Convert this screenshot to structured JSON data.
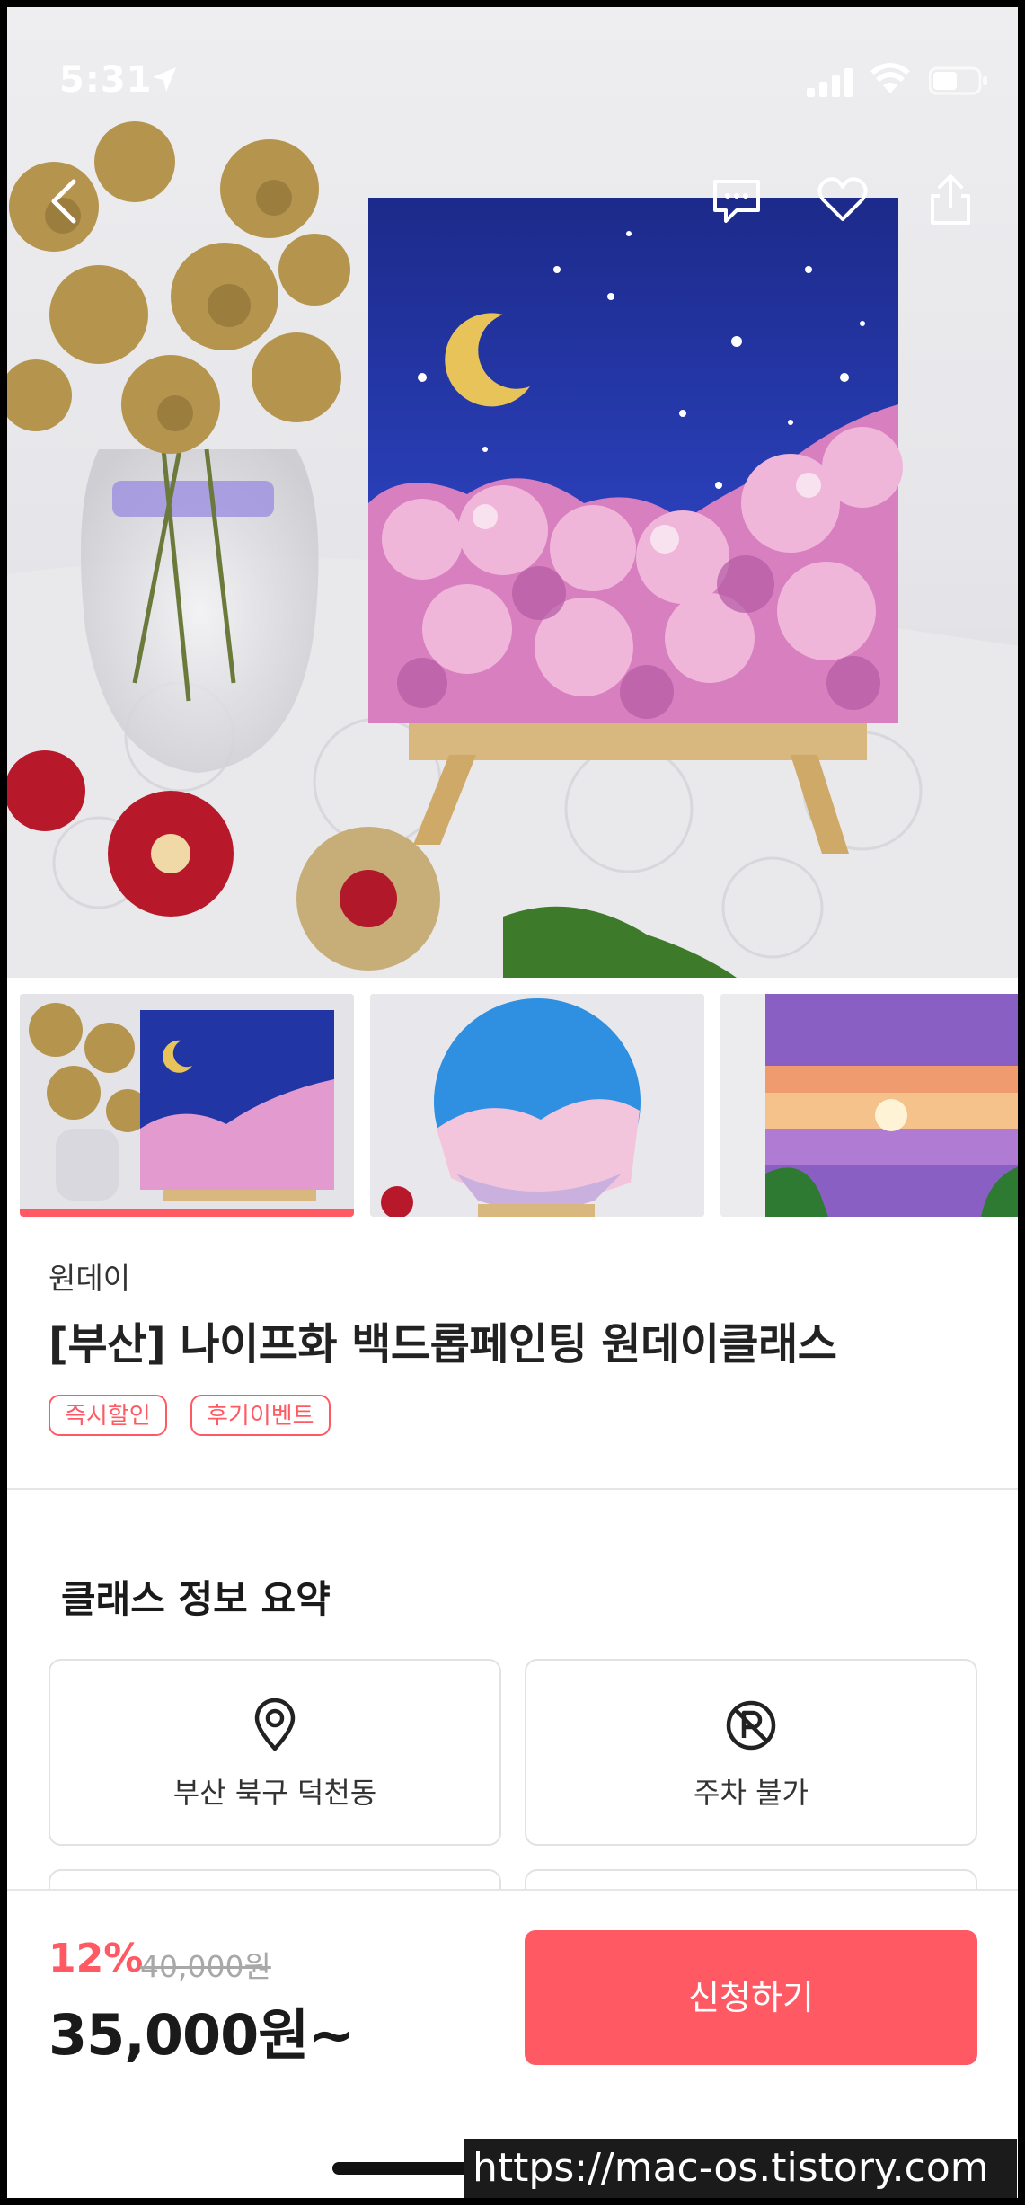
{
  "status_bar": {
    "time": "5:31"
  },
  "product": {
    "category": "원데이",
    "title": "[부산] 나이프화 백드롭페인팅 원데이클래스",
    "tags": [
      "즉시할인",
      "후기이벤트"
    ]
  },
  "summary": {
    "title": "클래스 정보 요약",
    "cards": [
      {
        "label": "부산 북구 덕천동",
        "icon": "location-pin-icon"
      },
      {
        "label": "주차 불가",
        "icon": "no-parking-icon"
      }
    ]
  },
  "purchase": {
    "discount": "12%",
    "original_price": "40,000원",
    "price": "35,000원~",
    "apply_label": "신청하기"
  },
  "watermark": "https://mac-os.tistory.com",
  "colors": {
    "accent": "#ff5a64",
    "text": "#222222",
    "divider": "#e6e6e6"
  }
}
